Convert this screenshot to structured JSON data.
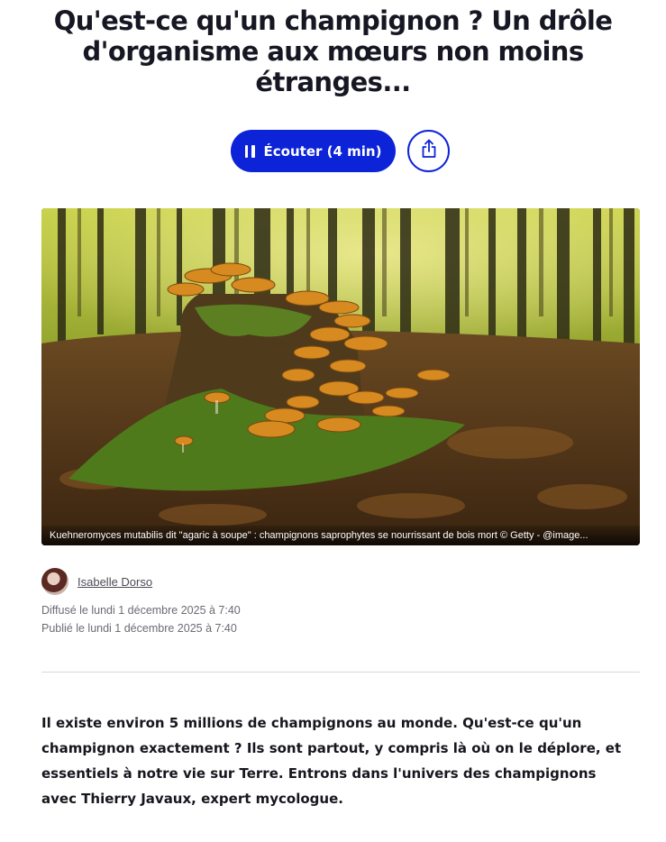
{
  "article": {
    "title": "Qu'est-ce qu'un champignon ? Un drôle d'organisme aux mœurs non moins étranges...",
    "listen_label": "Écouter (4 min)",
    "image_caption": "Kuehneromyces mutabilis dit \"agaric à soupe\" : champignons saprophytes se nourrissant de bois mort © Getty - @image...",
    "author_name": "Isabelle Dorso",
    "broadcast_date": "Diffusé le lundi 1 décembre 2025 à 7:40",
    "published_date": "Publié le lundi 1 décembre 2025 à 7:40",
    "lead": "Il existe environ 5 millions de champignons au monde. Qu'est-ce qu'un champignon exactement ? Ils sont partout, y compris là où on le déplore, et essentiels à notre vie sur Terre. Entrons dans l'univers des champignons avec Thierry Javaux, expert mycologue."
  },
  "icons": {
    "listen": "pause-icon",
    "share": "share-icon"
  },
  "colors": {
    "accent": "#0d23d8",
    "title": "#171723",
    "meta": "#6b6b74"
  }
}
